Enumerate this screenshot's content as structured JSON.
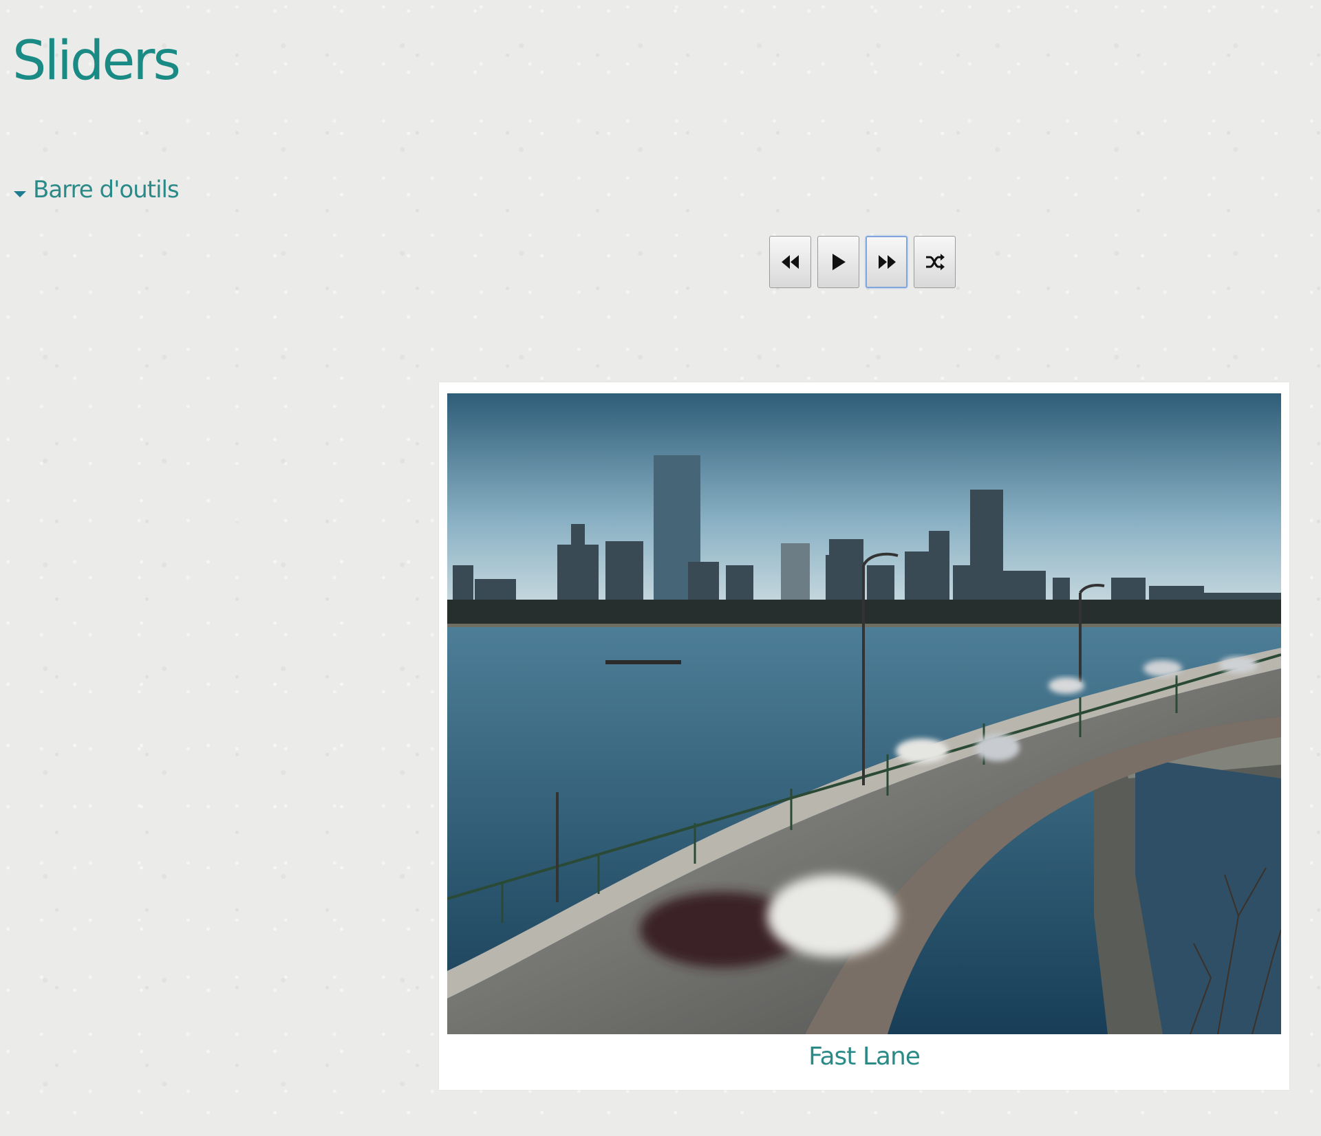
{
  "page": {
    "title": "Sliders"
  },
  "toolbar": {
    "toggle_label": "Barre d'outils",
    "expanded": true
  },
  "slider": {
    "controls": [
      {
        "name": "previous",
        "icon": "rewind-icon"
      },
      {
        "name": "play",
        "icon": "play-icon"
      },
      {
        "name": "next",
        "icon": "fast-forward-icon",
        "focused": true
      },
      {
        "name": "shuffle",
        "icon": "shuffle-icon"
      }
    ],
    "current_slide": {
      "caption": "Fast Lane"
    }
  },
  "colors": {
    "accent": "#1a8b84",
    "link": "#2a8a88",
    "focus_ring": "#7fa7de",
    "background": "#ebebea"
  }
}
